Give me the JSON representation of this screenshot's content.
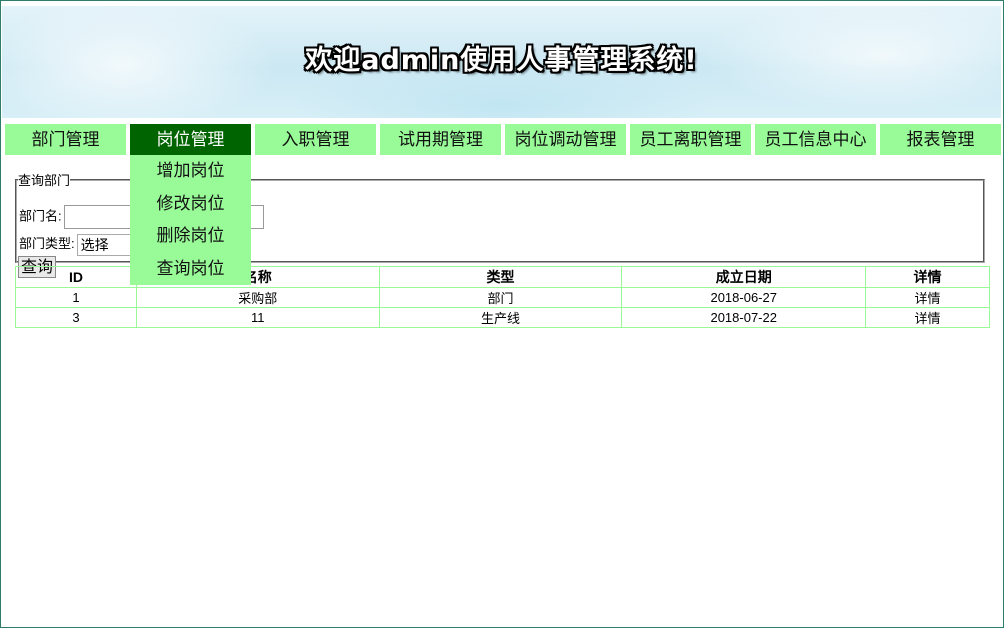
{
  "banner": {
    "title": "欢迎admin使用人事管理系统!"
  },
  "nav": {
    "items": [
      {
        "label": "部门管理"
      },
      {
        "label": "岗位管理"
      },
      {
        "label": "入职管理"
      },
      {
        "label": "试用期管理"
      },
      {
        "label": "岗位调动管理"
      },
      {
        "label": "员工离职管理"
      },
      {
        "label": "员工信息中心"
      },
      {
        "label": "报表管理"
      }
    ],
    "active_index": 1,
    "dropdown": [
      {
        "label": "增加岗位"
      },
      {
        "label": "修改岗位"
      },
      {
        "label": "删除岗位"
      },
      {
        "label": "查询岗位"
      }
    ]
  },
  "query": {
    "legend": "查询部门",
    "name_label": "部门名:",
    "name_value": "",
    "type_label": "部门类型:",
    "type_selected": "选择",
    "submit_label": "查询"
  },
  "table": {
    "headers": [
      "ID",
      "名称",
      "类型",
      "成立日期",
      "详情"
    ],
    "rows": [
      [
        "1",
        "采购部",
        "部门",
        "2018-06-27",
        "详情"
      ],
      [
        "3",
        "11",
        "生产线",
        "2018-07-22",
        "详情"
      ]
    ]
  },
  "colors": {
    "nav_bg": "#98fb98",
    "nav_active_bg": "#006400",
    "table_border": "#98fb98"
  }
}
